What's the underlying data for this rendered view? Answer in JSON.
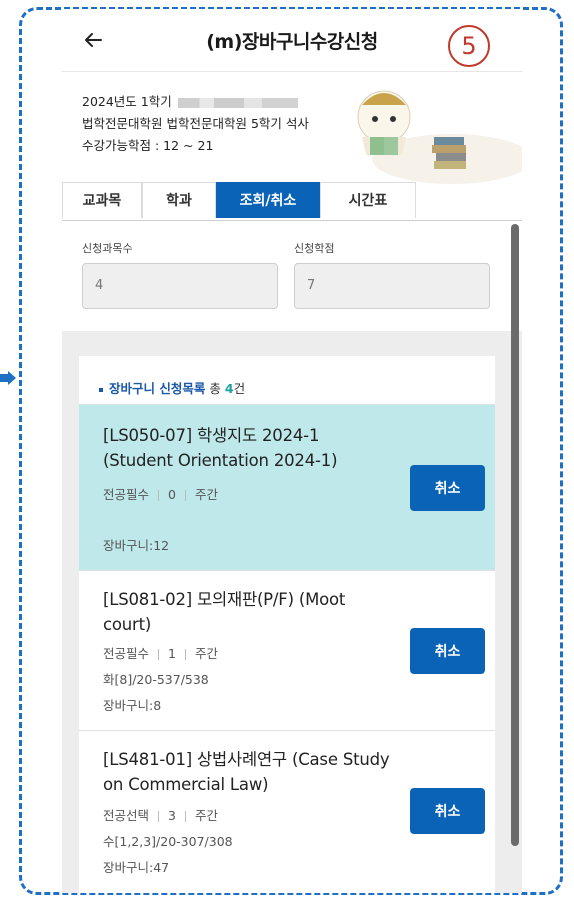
{
  "header": {
    "title": "(m)장바구니수강신청",
    "step_number": "5"
  },
  "info": {
    "semester": "2024년도 1학기",
    "program": "법학전문대학원 법학전문대학원 5학기 석사",
    "credit_range": "수강가능학점 : 12 ~ 21"
  },
  "tabs": [
    {
      "label": "교과목",
      "active": false
    },
    {
      "label": "학과",
      "active": false
    },
    {
      "label": "조회/취소",
      "active": true
    },
    {
      "label": "시간표",
      "active": false
    }
  ],
  "summary": {
    "course_count_label": "신청과목수",
    "course_count_value": "4",
    "credit_label": "신청학점",
    "credit_value": "7"
  },
  "cart": {
    "title": "장바구니 신청목록",
    "total_prefix": "총",
    "count": "4",
    "count_suffix": "건",
    "items": [
      {
        "name": "[LS050-07] 학생지도 2024-1 (Student Orientation 2024-1)",
        "type": "전공필수",
        "credit": "0",
        "time_type": "주간",
        "schedule": "",
        "cart_count": "장바구니:12",
        "cancel_label": "취소",
        "selected": true
      },
      {
        "name": "[LS081-02] 모의재판(P/F) (Moot court)",
        "type": "전공필수",
        "credit": "1",
        "time_type": "주간",
        "schedule": "화[8]/20-537/538",
        "cart_count": "장바구니:8",
        "cancel_label": "취소",
        "selected": false
      },
      {
        "name": "[LS481-01] 상법사례연구 (Case Study on Commercial Law)",
        "type": "전공선택",
        "credit": "3",
        "time_type": "주간",
        "schedule": "수[1,2,3]/20-307/308",
        "cart_count": "장바구니:47",
        "cancel_label": "취소",
        "selected": false
      }
    ]
  },
  "colors": {
    "accent": "#0b63b8",
    "selected_row": "#bfe8ea",
    "frame_border": "#1f6fc5",
    "step_badge": "#c0392b"
  },
  "icons": {
    "back": "arrow-left-icon",
    "mascot": "mascot-reading-illustration"
  }
}
